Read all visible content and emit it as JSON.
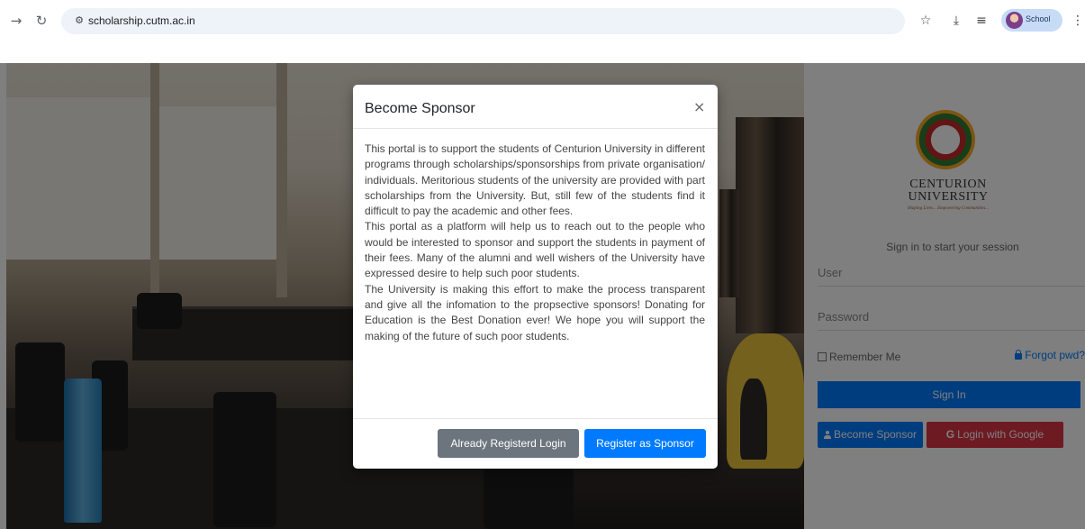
{
  "browser": {
    "url": "scholarship.cutm.ac.in",
    "profile_label": "School"
  },
  "login": {
    "university_name_line1": "CENTURION",
    "university_name_line2": "UNIVERSITY",
    "university_tagline": "Shaping Lives... Empowering Communities...",
    "signin_message": "Sign in to start your session",
    "user_placeholder": "User",
    "password_placeholder": "Password",
    "remember_label": "Remember Me",
    "forgot_label": "Forgot pwd?",
    "signin_button": "Sign In",
    "become_sponsor_button": "Become Sponsor",
    "google_button": "Login with Google"
  },
  "modal": {
    "title": "Become Sponsor",
    "close_glyph": "×",
    "paragraphs": [
      "This portal is to support the students of Centurion University in different programs through scholarships/sponsorships from private organisation/ individuals. Meritorious students of the university are provided with part scholarships from the University. But, still few of the students find it difficult to pay the academic and other fees.",
      "This portal as a platform will help us to reach out to the people who would be interested to sponsor and support the students in payment of their fees. Many of the alumni and well wishers of the University have expressed desire to help such poor students.",
      "The University is making this effort to make the process transparent and give all the infomation to the propsective sponsors! Donating for Education is the Best Donation ever! We hope you will support the making of the future of such poor students."
    ],
    "secondary_button": "Already Registerd Login",
    "primary_button": "Register as Sponsor"
  }
}
